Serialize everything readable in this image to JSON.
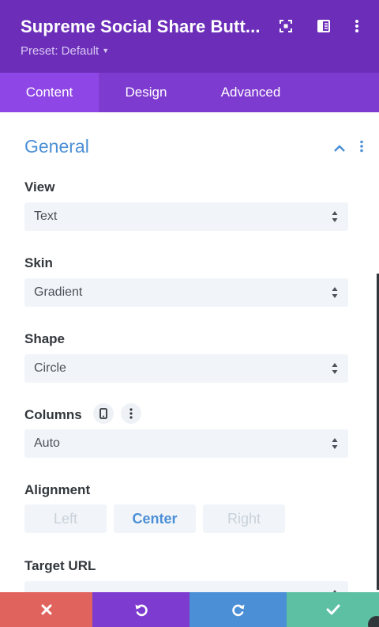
{
  "header": {
    "title": "Supreme Social Share Butt...",
    "preset": "Preset: Default",
    "bg_color": "#6c2eb9",
    "icons": [
      "fullscreen-icon",
      "sidebar-toggle-icon",
      "more-options-icon"
    ]
  },
  "tabs": [
    {
      "label": "Content",
      "active": true
    },
    {
      "label": "Design",
      "active": false
    },
    {
      "label": "Advanced",
      "active": false
    }
  ],
  "section": {
    "title": "General",
    "accent_color": "#4b8fd6",
    "icons": [
      "chevron-up-icon",
      "section-menu-icon"
    ]
  },
  "fields": {
    "view": {
      "label": "View",
      "value": "Text"
    },
    "skin": {
      "label": "Skin",
      "value": "Gradient"
    },
    "shape": {
      "label": "Shape",
      "value": "Circle"
    },
    "columns": {
      "label": "Columns",
      "value": "Auto",
      "icons": [
        "mobile-icon",
        "options-dots-icon"
      ]
    },
    "alignment": {
      "label": "Alignment",
      "options": [
        "Left",
        "Center",
        "Right"
      ],
      "selected": "Center"
    },
    "target_url": {
      "label": "Target URL"
    }
  },
  "footer": {
    "buttons": [
      {
        "name": "discard",
        "icon": "close-icon",
        "color": "#e0645d"
      },
      {
        "name": "undo",
        "icon": "undo-icon",
        "color": "#7d3bcf"
      },
      {
        "name": "redo",
        "icon": "redo-icon",
        "color": "#4b8fd6"
      },
      {
        "name": "save",
        "icon": "check-icon",
        "color": "#5ec0a3"
      }
    ]
  }
}
